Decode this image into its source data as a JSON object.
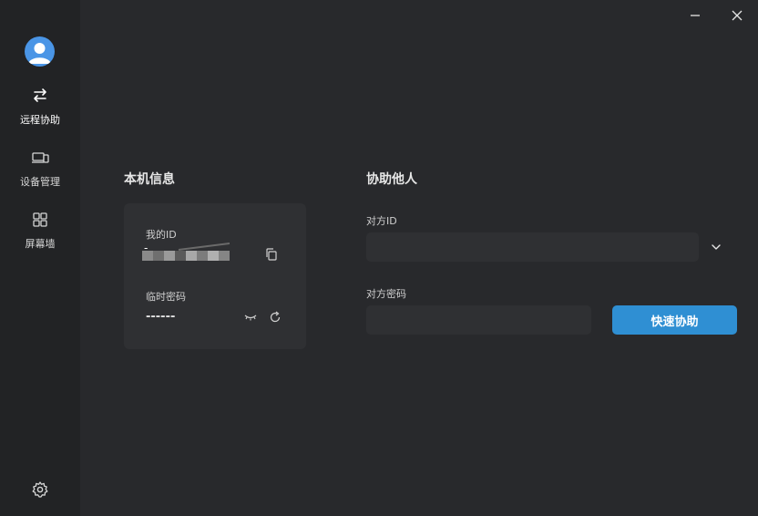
{
  "window": {
    "minimize_icon": "minimize-icon",
    "close_icon": "close-icon"
  },
  "sidebar": {
    "avatar_icon": "user-avatar-icon",
    "items": [
      {
        "label": "远程协助",
        "icon": "swap-arrows-icon",
        "active": true
      },
      {
        "label": "设备管理",
        "icon": "devices-icon",
        "active": false
      },
      {
        "label": "屏幕墙",
        "icon": "grid-icon",
        "active": false
      }
    ],
    "settings_icon": "gear-icon"
  },
  "local_info": {
    "title": "本机信息",
    "my_id_label": "我的ID",
    "my_id_value": "-",
    "temp_password_label": "临时密码",
    "temp_password_value": "------",
    "copy_icon": "copy-icon",
    "hide_icon": "eye-closed-icon",
    "refresh_icon": "refresh-icon"
  },
  "help_others": {
    "title": "协助他人",
    "peer_id_label": "对方ID",
    "peer_id_value": "",
    "peer_password_label": "对方密码",
    "peer_password_value": "",
    "dropdown_icon": "chevron-down-icon",
    "connect_button": "快速协助"
  },
  "colors": {
    "background": "#28292c",
    "sidebar": "#222325",
    "card": "#2f3033",
    "accent": "#2f8fd3",
    "avatar": "#4a95e6"
  }
}
